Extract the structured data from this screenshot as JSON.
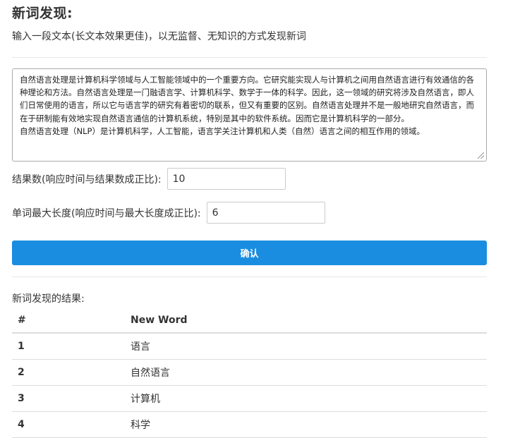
{
  "header": {
    "title": "新词发现:",
    "subtitle": "输入一段文本(长文本效果更佳)，以无监督、无知识的方式发现新词"
  },
  "form": {
    "text_value": "自然语言处理是计算机科学领域与人工智能领域中的一个重要方向。它研究能实现人与计算机之间用自然语言进行有效通信的各种理论和方法。自然语言处理是一门融语言学、计算机科学、数学于一体的科学。因此，这一领域的研究将涉及自然语言，即人们日常使用的语言，所以它与语言学的研究有着密切的联系，但又有重要的区别。自然语言处理并不是一般地研究自然语言，而在于研制能有效地实现自然语言通信的计算机系统，特别是其中的软件系统。因而它是计算机科学的一部分。\n自然语言处理（NLP）是计算机科学，人工智能，语言学关注计算机和人类（自然）语言之间的相互作用的领域。",
    "result_count_label": "结果数(响应时间与结果数成正比):",
    "result_count_value": "10",
    "max_length_label": "单词最大长度(响应时间与最大长度成正比):",
    "max_length_value": "6",
    "confirm_label": "确认"
  },
  "results": {
    "label": "新词发现的结果:",
    "columns": [
      "#",
      "New Word"
    ],
    "rows": [
      {
        "num": "1",
        "word": "语言"
      },
      {
        "num": "2",
        "word": "自然语言"
      },
      {
        "num": "3",
        "word": "计算机"
      },
      {
        "num": "4",
        "word": "科学"
      }
    ]
  },
  "colors": {
    "accent": "#1a8de0",
    "text": "#333333",
    "border": "#dddddd"
  }
}
